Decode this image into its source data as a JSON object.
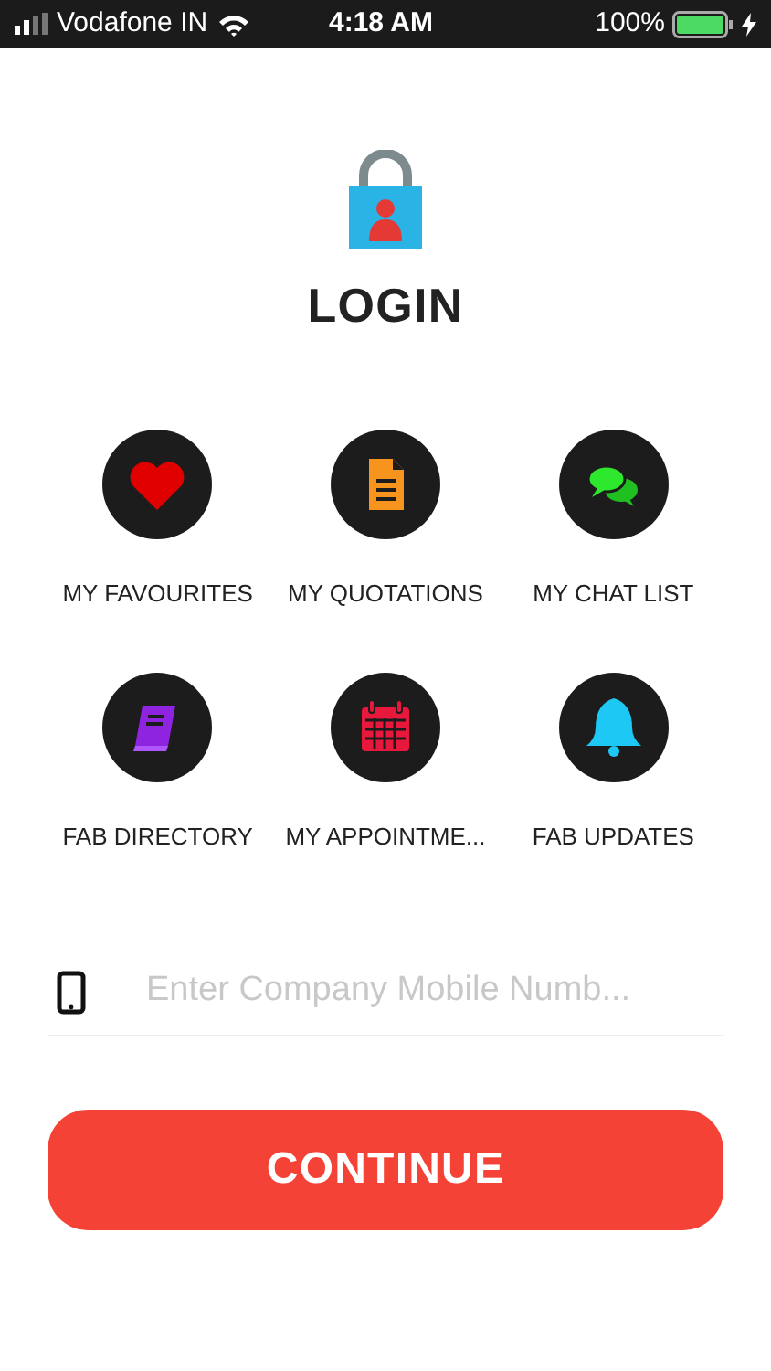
{
  "status_bar": {
    "carrier": "Vodafone IN",
    "time": "4:18 AM",
    "battery": "100%"
  },
  "title": "LOGIN",
  "menu": [
    {
      "label": "MY FAVOURITES",
      "kind": "heart"
    },
    {
      "label": "MY QUOTATIONS",
      "kind": "document"
    },
    {
      "label": "MY CHAT LIST",
      "kind": "chat"
    },
    {
      "label": "FAB DIRECTORY",
      "kind": "book"
    },
    {
      "label": "MY APPOINTME...",
      "kind": "calendar"
    },
    {
      "label": "FAB UPDATES",
      "kind": "bell"
    }
  ],
  "mobile_field": {
    "placeholder": "Enter Company Mobile Numb..."
  },
  "continue_button": "CONTINUE"
}
